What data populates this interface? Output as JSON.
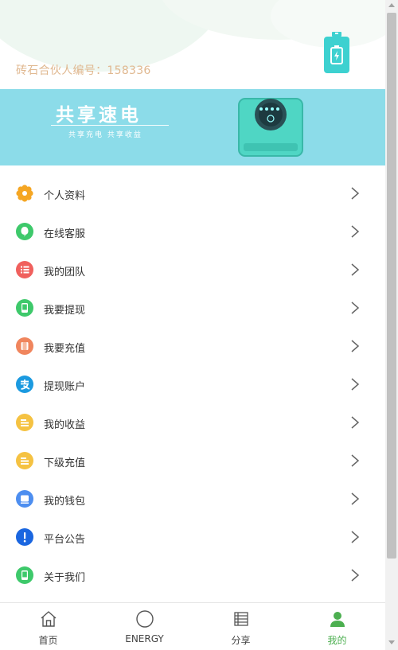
{
  "header": {
    "partner_id_text": "砖石合伙人编号：158336"
  },
  "banner": {
    "title": "共享速电",
    "subtitle": "共享充电 共享收益"
  },
  "menu": {
    "items": [
      {
        "label": "个人资料",
        "icon": "gear-icon",
        "color": "#f5a623"
      },
      {
        "label": "在线客服",
        "icon": "chat-bubble-icon",
        "color": "#3ec96b"
      },
      {
        "label": "我的团队",
        "icon": "list-icon",
        "color": "#f0605d"
      },
      {
        "label": "我要提现",
        "icon": "phone-icon",
        "color": "#3ec96b"
      },
      {
        "label": "我要充值",
        "icon": "card-icon",
        "color": "#f0855d"
      },
      {
        "label": "提现账户",
        "icon": "alipay-icon",
        "color": "#1b9ae0"
      },
      {
        "label": "我的收益",
        "icon": "stack-icon",
        "color": "#f5c242"
      },
      {
        "label": "下级充值",
        "icon": "stack-icon",
        "color": "#f5c242"
      },
      {
        "label": "我的钱包",
        "icon": "wallet-icon",
        "color": "#4d8ef0"
      },
      {
        "label": "平台公告",
        "icon": "exclamation-icon",
        "color": "#1a66e0"
      },
      {
        "label": "关于我们",
        "icon": "phone-icon",
        "color": "#3ec96b"
      }
    ]
  },
  "tabbar": {
    "tabs": [
      {
        "label": "首页",
        "icon": "home-icon"
      },
      {
        "label": "ENERGY",
        "icon": "circle-icon"
      },
      {
        "label": "分享",
        "icon": "share-list-icon"
      },
      {
        "label": "我的",
        "icon": "user-icon",
        "active": true
      }
    ]
  },
  "colors": {
    "accent": "#4caf50",
    "banner_bg": "#8cdce9",
    "battery": "#3dd1d0",
    "partner_text": "#e0b890"
  }
}
